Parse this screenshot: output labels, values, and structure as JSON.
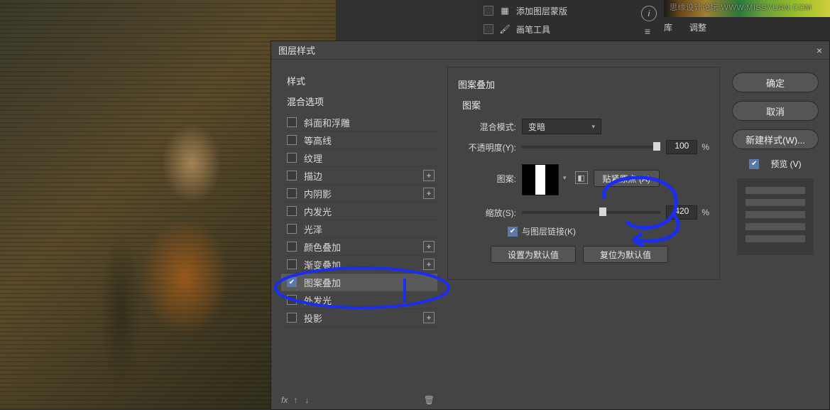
{
  "watermark": "思缘设计论坛  WWW.MISSYUAN.COM",
  "top_right": {
    "item_mask": "添加图层蒙版",
    "item_brush": "画笔工具"
  },
  "right_tabs": {
    "lib": "库",
    "adjust": "调整"
  },
  "dialog": {
    "title": "图层样式",
    "close": "×",
    "styles_header": "样式",
    "blend_opts": "混合选项",
    "styles": [
      {
        "label": "斜面和浮雕",
        "checked": false,
        "plus": false
      },
      {
        "label": "等高线",
        "checked": false,
        "plus": false
      },
      {
        "label": "纹理",
        "checked": false,
        "plus": false
      },
      {
        "label": "描边",
        "checked": false,
        "plus": true
      },
      {
        "label": "内阴影",
        "checked": false,
        "plus": true
      },
      {
        "label": "内发光",
        "checked": false,
        "plus": false
      },
      {
        "label": "光泽",
        "checked": false,
        "plus": false
      },
      {
        "label": "颜色叠加",
        "checked": false,
        "plus": true
      },
      {
        "label": "渐变叠加",
        "checked": false,
        "plus": true
      },
      {
        "label": "图案叠加",
        "checked": true,
        "plus": false,
        "selected": true
      },
      {
        "label": "外发光",
        "checked": false,
        "plus": false
      },
      {
        "label": "投影",
        "checked": false,
        "plus": true
      }
    ],
    "panel": {
      "title": "图案叠加",
      "group": "图案",
      "blend_mode_label": "混合模式:",
      "blend_mode_value": "变暗",
      "opacity_label": "不透明度(Y):",
      "opacity_value": "100",
      "pattern_label": "图案:",
      "snap_btn": "贴紧原点 (A)",
      "scale_label": "缩放(S):",
      "scale_value": "420",
      "percent": "%",
      "link_layer": "与图层链接(K)",
      "set_default": "设置为默认值",
      "reset_default": "复位为默认值"
    },
    "buttons": {
      "ok": "确定",
      "cancel": "取消",
      "new_style": "新建样式(W)...",
      "preview": "预览 (V)"
    },
    "footer": {
      "fx": "fx"
    }
  }
}
